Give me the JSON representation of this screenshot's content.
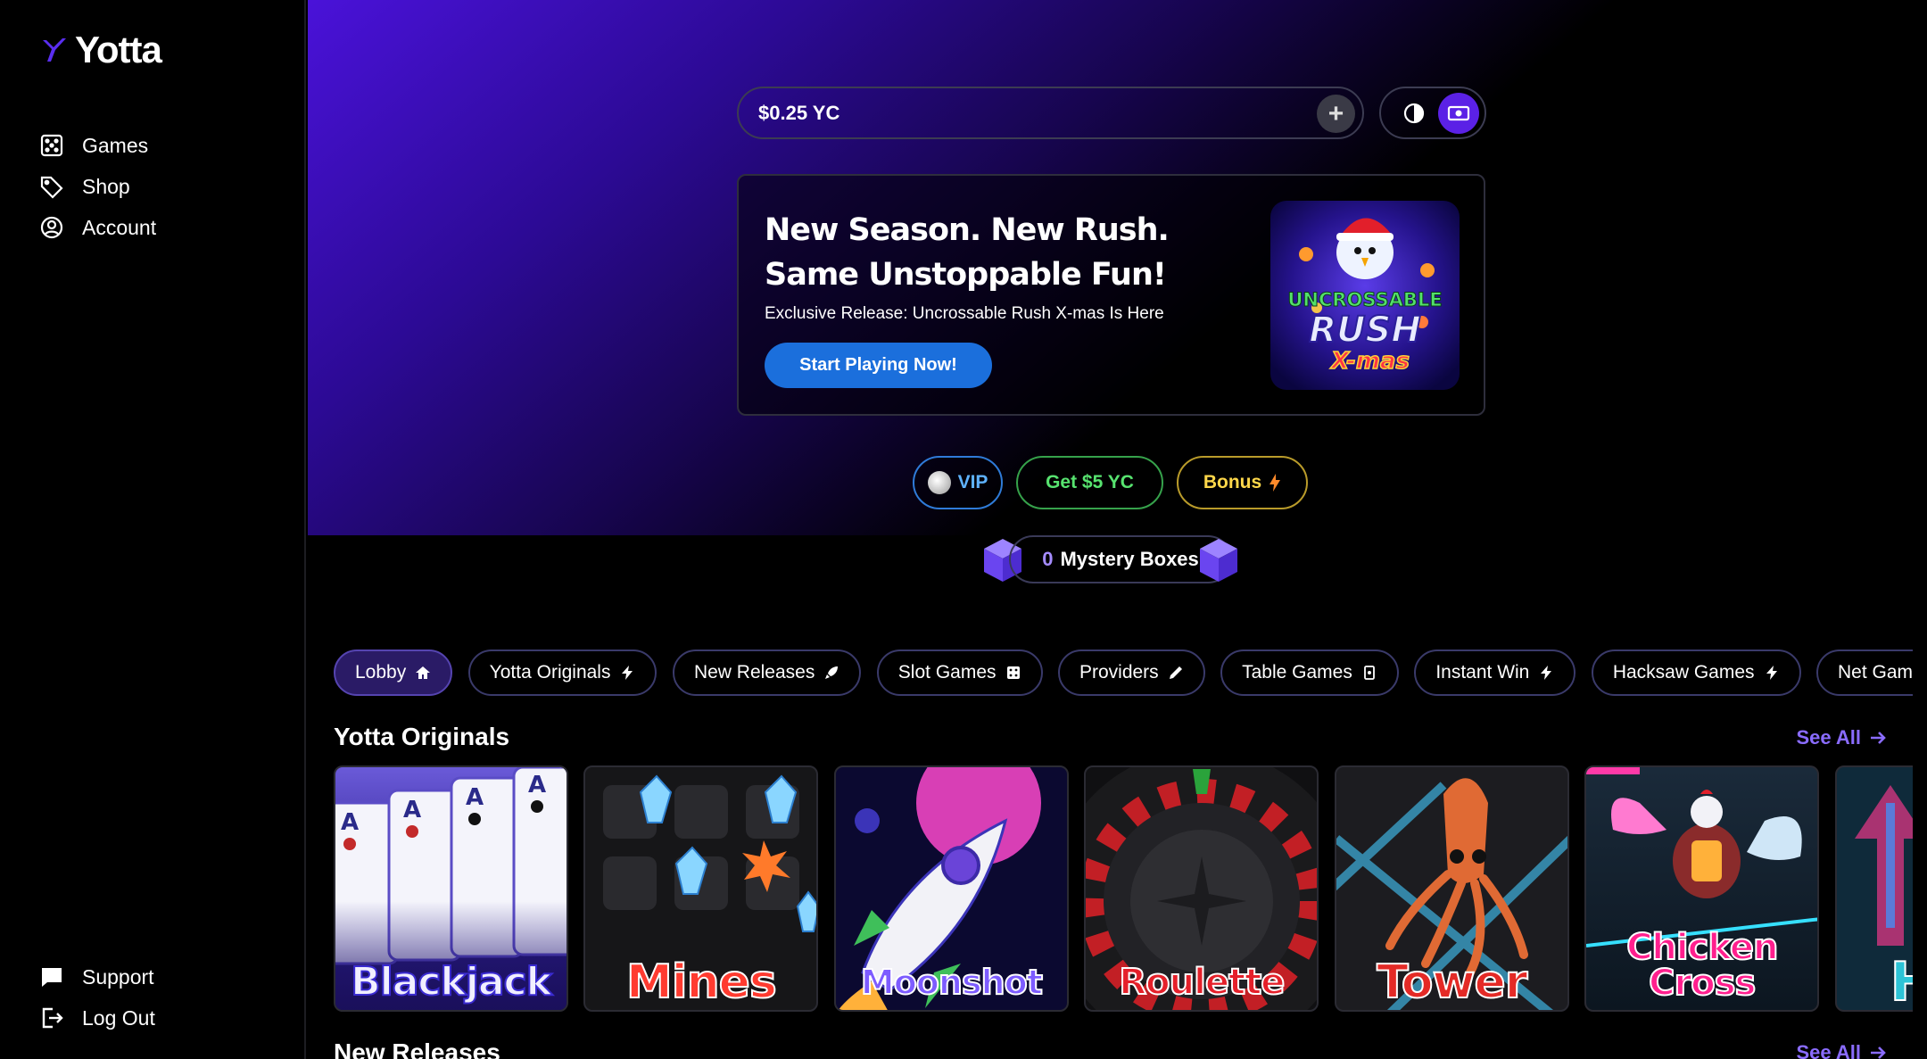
{
  "brand": {
    "name": "Yotta",
    "accent": "#5b21e6"
  },
  "sidebar": {
    "items": [
      {
        "label": "Games",
        "icon": "dice-icon"
      },
      {
        "label": "Shop",
        "icon": "tag-icon"
      },
      {
        "label": "Account",
        "icon": "user-circle-icon"
      }
    ],
    "bottom": [
      {
        "label": "Support",
        "icon": "chat-icon"
      },
      {
        "label": "Log Out",
        "icon": "logout-icon"
      }
    ]
  },
  "balance": {
    "value": "$0.25 YC",
    "add_icon": "plus-icon"
  },
  "toggles": [
    {
      "icon": "contrast-icon"
    },
    {
      "icon": "cash-icon"
    }
  ],
  "promo": {
    "title_line1": "New Season. New Rush.",
    "title_line2": "Same Unstoppable Fun!",
    "subtitle": "Exclusive Release: Uncrossable Rush X-mas Is Here",
    "cta": "Start Playing Now!",
    "art_line1": "UNCROSSABLE",
    "art_line2": "RUSH",
    "art_line3": "X-mas"
  },
  "pills": {
    "vip": "VIP",
    "get": "Get $5 YC",
    "bonus": "Bonus"
  },
  "mystery": {
    "count": "0",
    "label": "Mystery Boxes"
  },
  "categories": [
    {
      "label": "Lobby",
      "icon": "home-icon"
    },
    {
      "label": "Yotta Originals",
      "icon": "bolt-icon"
    },
    {
      "label": "New Releases",
      "icon": "rocket-icon"
    },
    {
      "label": "Slot Games",
      "icon": "dice-icon"
    },
    {
      "label": "Providers",
      "icon": "pen-icon"
    },
    {
      "label": "Table Games",
      "icon": "card-icon"
    },
    {
      "label": "Instant Win",
      "icon": "bolt-icon"
    },
    {
      "label": "Hacksaw Games",
      "icon": "bolt-icon"
    },
    {
      "label": "Net Games",
      "icon": "bolt-icon"
    }
  ],
  "sections": {
    "originals": {
      "title": "Yotta Originals",
      "see_all": "See All"
    },
    "new_releases": {
      "title": "New Releases",
      "see_all": "See All"
    }
  },
  "games": [
    {
      "name": "Blackjack",
      "color": "#2c1e8f"
    },
    {
      "name": "Mines",
      "color": "#ff3b30"
    },
    {
      "name": "Moonshot",
      "color": "#3b2bd1"
    },
    {
      "name": "Roulette",
      "color": "#e5202a"
    },
    {
      "name": "Tower",
      "color": "#e42a26"
    },
    {
      "name": "Chicken Cross",
      "color": "#ff1f8e"
    },
    {
      "name": "H",
      "color": "#2dc3d6"
    }
  ]
}
